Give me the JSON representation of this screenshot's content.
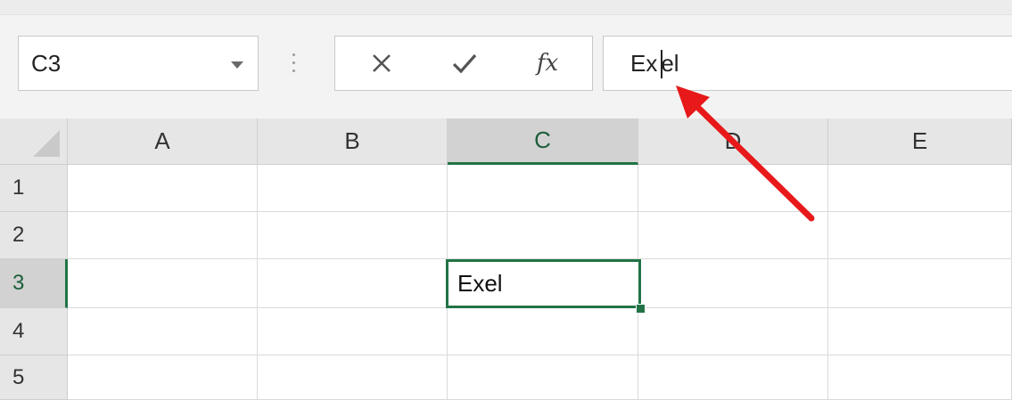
{
  "name_box": {
    "value": "C3"
  },
  "formula_bar": {
    "cancel_icon": "close-icon",
    "enter_icon": "checkmark-icon",
    "function_label": "fx",
    "value_before_caret": "Ex",
    "value_after_caret": "el"
  },
  "columns": [
    "A",
    "B",
    "C",
    "D",
    "E"
  ],
  "rows": [
    "1",
    "2",
    "3",
    "4",
    "5"
  ],
  "selected": {
    "column": "C",
    "row": "3"
  },
  "cells": {
    "C3": "Exel"
  },
  "annotation": {
    "color": "#e8191a"
  },
  "accent_color": "#217346"
}
